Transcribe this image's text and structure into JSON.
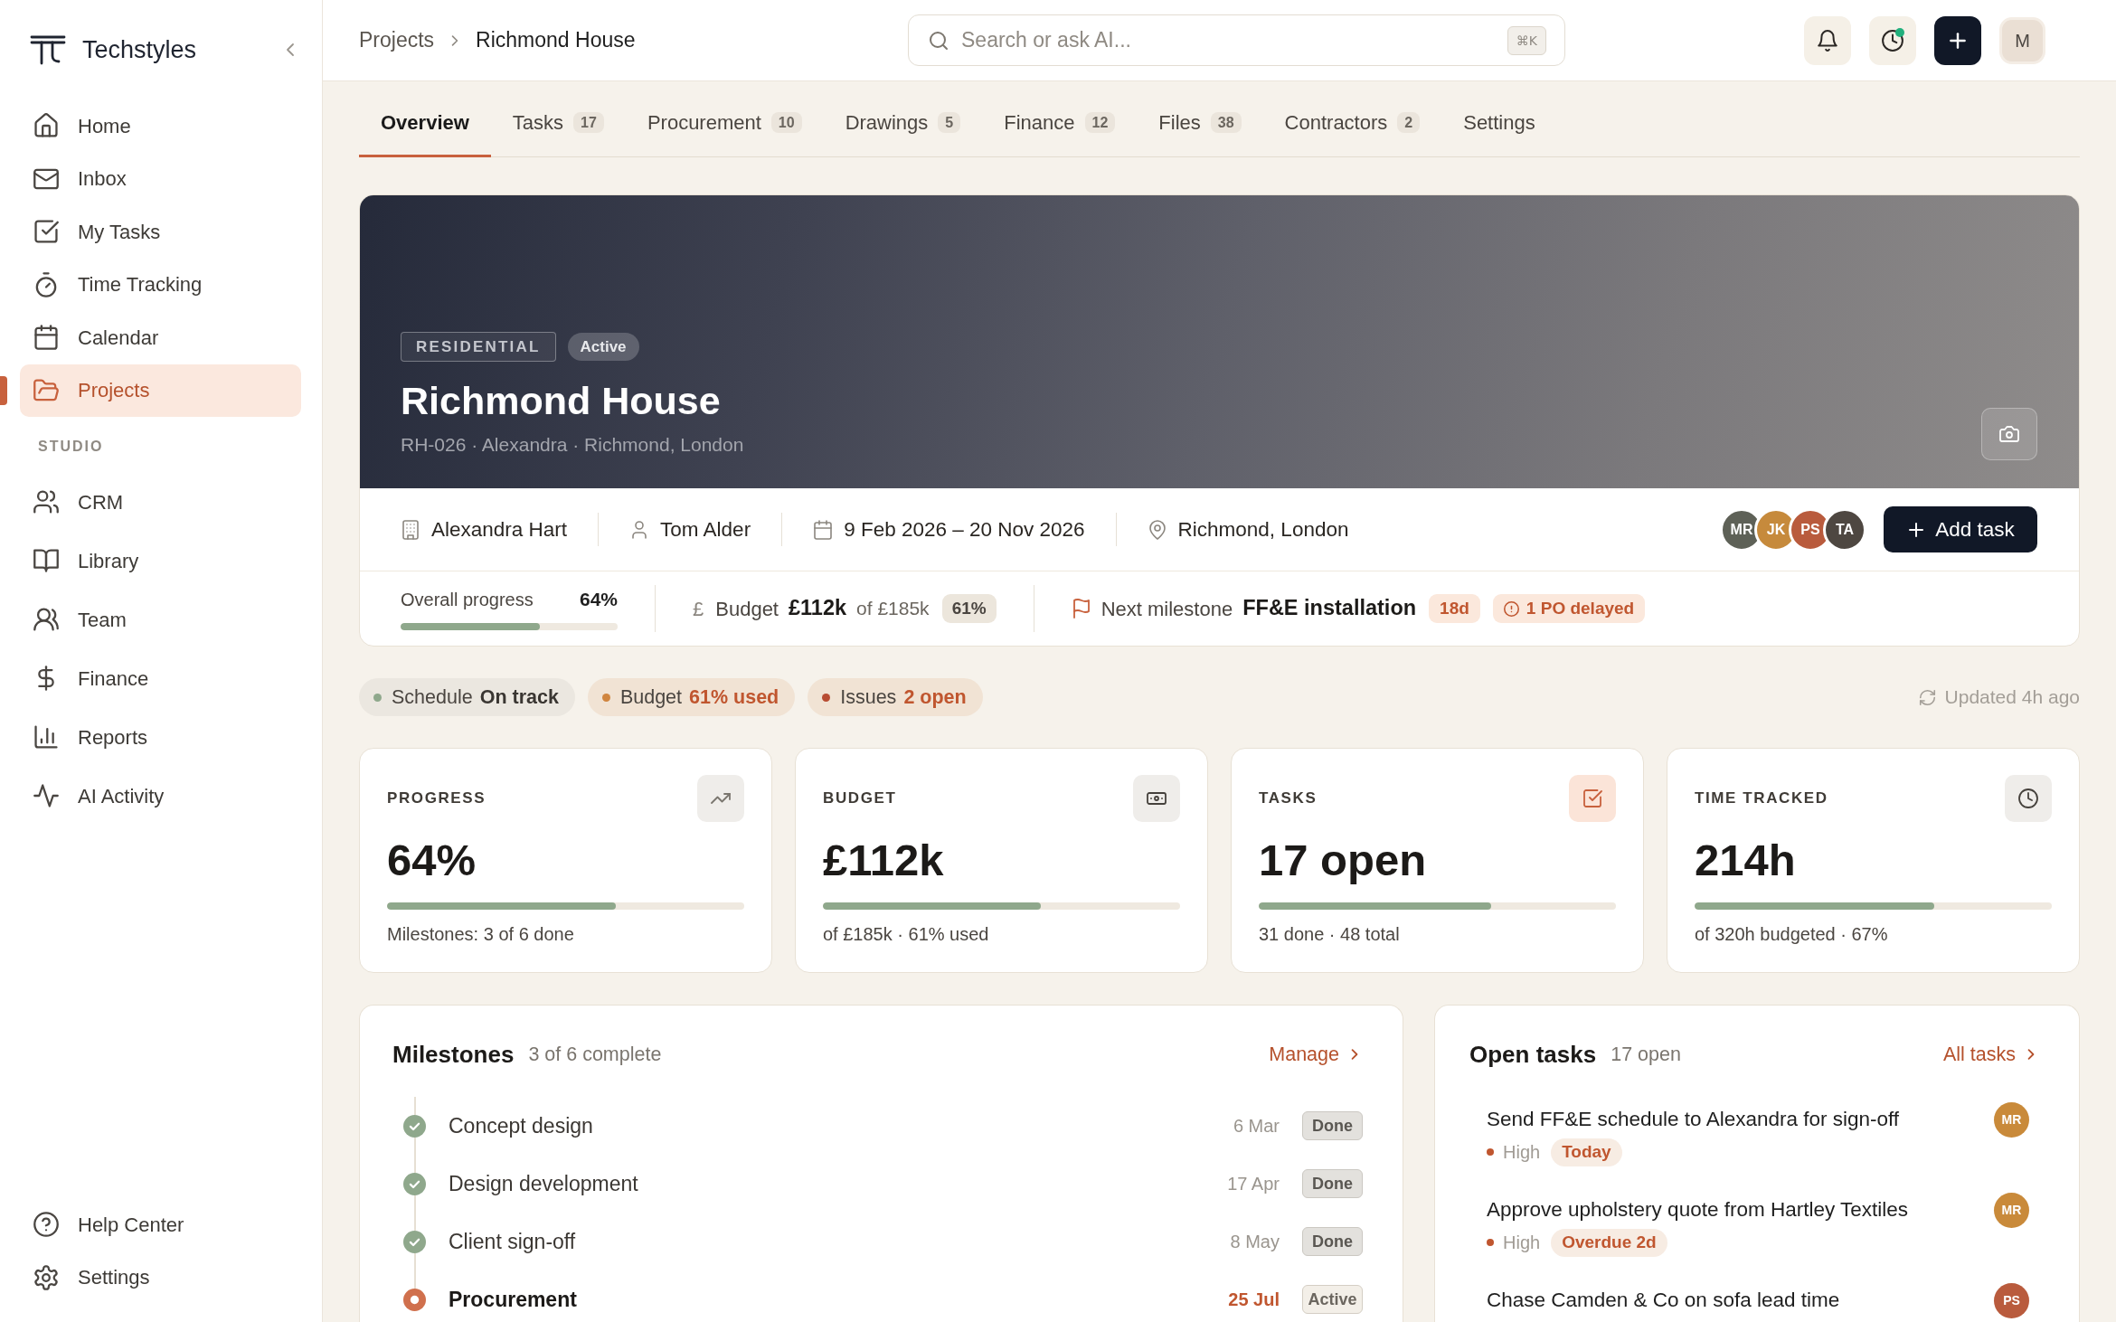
{
  "sidebar": {
    "brand": "Techstyles",
    "main_items": [
      {
        "label": "Home",
        "selected": false
      },
      {
        "label": "Inbox",
        "selected": false
      },
      {
        "label": "My Tasks",
        "selected": false
      },
      {
        "label": "Time Tracking",
        "selected": false
      },
      {
        "label": "Calendar",
        "selected": false
      },
      {
        "label": "Projects",
        "selected": true
      }
    ],
    "section_label": "STUDIO",
    "studio_items": [
      {
        "label": "CRM",
        "selected": false
      },
      {
        "label": "Library",
        "selected": false
      },
      {
        "label": "Team",
        "selected": false
      },
      {
        "label": "Finance",
        "selected": false
      },
      {
        "label": "Reports",
        "selected": false
      },
      {
        "label": "AI Activity",
        "selected": false
      }
    ],
    "footer_items": [
      {
        "label": "Help Center",
        "selected": false
      },
      {
        "label": "Settings",
        "selected": false
      }
    ]
  },
  "breadcrumb": [
    "Projects",
    "Richmond House"
  ],
  "search": {
    "placeholder": "Search or ask AI...",
    "shortcut": "⌘K"
  },
  "header_actions": {
    "timer_running": true,
    "avatar": "M"
  },
  "tabs": [
    {
      "label": "Overview",
      "selected": true
    },
    {
      "label": "Tasks",
      "count": "17",
      "selected": false
    },
    {
      "label": "Procurement",
      "count": "10",
      "selected": false
    },
    {
      "label": "Drawings",
      "count": "5",
      "selected": false
    },
    {
      "label": "Finance",
      "count": "12",
      "selected": false
    },
    {
      "label": "Files",
      "count": "38",
      "selected": false
    },
    {
      "label": "Contractors",
      "count": "2",
      "selected": false
    },
    {
      "label": "Settings",
      "selected": false
    }
  ],
  "project": {
    "type_tag": "RESIDENTIAL",
    "status": "Active",
    "title": "Richmond House",
    "subtitle": "RH-026 · Alexandra · Richmond, London",
    "details": [
      "Alexandra Hart",
      "Tom Alder",
      "9 Feb 2026 – 20 Nov 2026",
      "Richmond, London"
    ],
    "team": [
      {
        "initials": "MR",
        "color": "#5e6157"
      },
      {
        "initials": "JK",
        "color": "#c68a3c"
      },
      {
        "initials": "PS",
        "color": "#b95b3d"
      },
      {
        "initials": "TA",
        "color": "#4e4741"
      }
    ],
    "add_button": "Add task",
    "progress": {
      "label": "Overall progress",
      "value": "64%",
      "level": 0.64
    },
    "budget": {
      "symbol": "£",
      "label": "Budget",
      "spent": "£112k",
      "total": "of £185k",
      "share": "61%"
    },
    "next_milestone": {
      "label": "Next milestone",
      "name": "FF&E installation",
      "due_in": "18d",
      "alert": "1 PO delayed"
    }
  },
  "status_pills": [
    {
      "label": "Schedule",
      "value": "On track",
      "color": "#8fa88c",
      "kind": "ok"
    },
    {
      "label": "Budget",
      "value": "61% used",
      "color": "#d0853f",
      "kind": "alert"
    },
    {
      "label": "Issues",
      "value": "2 open",
      "color": "#b84c32",
      "kind": "alert"
    }
  ],
  "updated": "Updated 4h ago",
  "metrics": [
    {
      "label": "PROGRESS",
      "value": "64%",
      "level": 0.64,
      "note": "Milestones: 3 of 6 done",
      "highlighted": false
    },
    {
      "label": "BUDGET",
      "value": "£112k",
      "level": 0.61,
      "note": "of £185k · 61% used",
      "highlighted": false
    },
    {
      "label": "TASKS",
      "value": "17 open",
      "level": 0.65,
      "note": "31 done · 48 total",
      "highlighted": true
    },
    {
      "label": "TIME TRACKED",
      "value": "214h",
      "level": 0.67,
      "note": "of 320h budgeted · 67%",
      "highlighted": false
    }
  ],
  "milestones": {
    "title": "Milestones",
    "summary": "3 of 6 complete",
    "link": "Manage",
    "items": [
      {
        "name": "Concept design",
        "date": "6 Mar",
        "status": "Done",
        "kind": "done"
      },
      {
        "name": "Design development",
        "date": "17 Apr",
        "status": "Done",
        "kind": "done"
      },
      {
        "name": "Client sign-off",
        "date": "8 May",
        "status": "Done",
        "kind": "done"
      },
      {
        "name": "Procurement",
        "date": "25 Jul",
        "status": "Active",
        "kind": "active"
      }
    ]
  },
  "open_tasks": {
    "title": "Open tasks",
    "summary": "17 open",
    "link": "All tasks",
    "items": [
      {
        "title": "Send FF&E schedule to Alexandra for sign-off",
        "priority": "High",
        "due": "Today",
        "assignee": "MR",
        "color": "#c98a3a"
      },
      {
        "title": "Approve upholstery quote from Hartley Textiles",
        "priority": "High",
        "due": "Overdue 2d",
        "assignee": "MR",
        "color": "#c98a3a"
      },
      {
        "title": "Chase Camden & Co on sofa lead time",
        "assignee": "PS",
        "color": "#b95b3d"
      }
    ]
  }
}
